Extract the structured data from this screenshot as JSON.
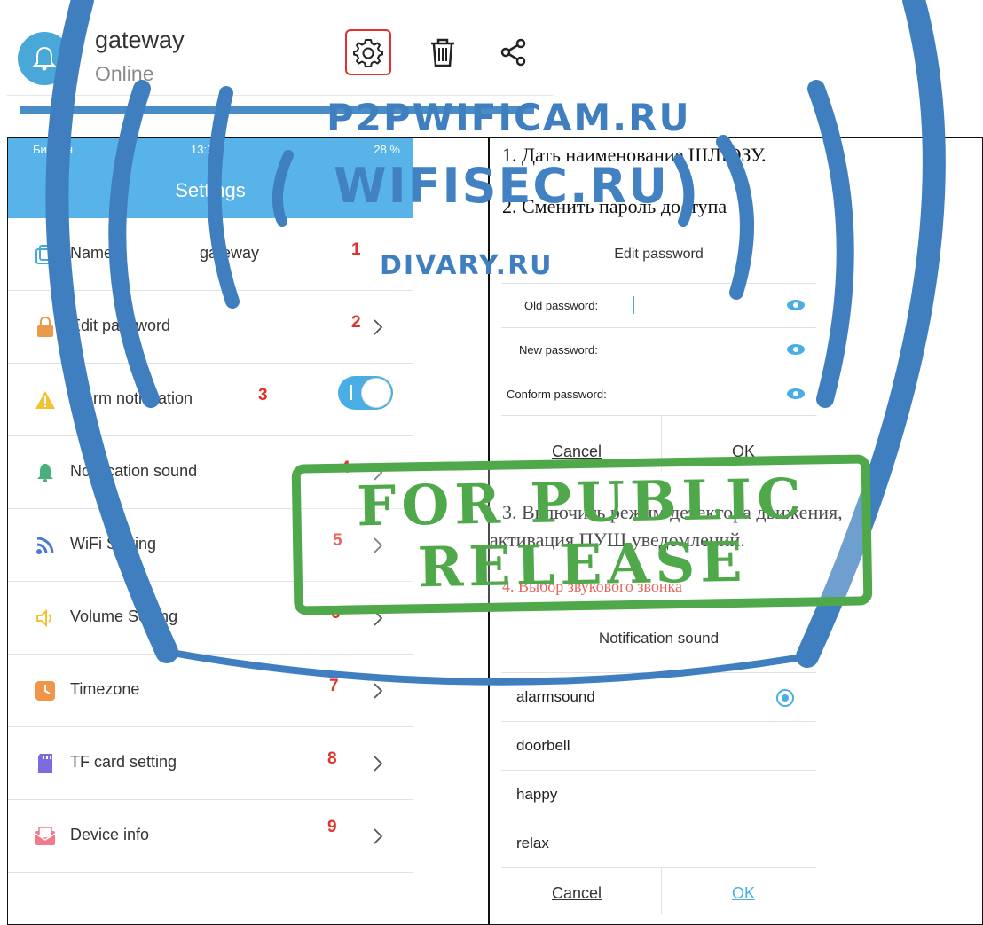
{
  "device": {
    "name": "gateway",
    "status": "Online"
  },
  "phone": {
    "carrier": "Билайн",
    "clock": "13:32",
    "battery": "28 %",
    "title": "Settings",
    "rows": [
      {
        "label": "Name",
        "value": "gateway",
        "num": "1"
      },
      {
        "label": "Edit password",
        "num": "2"
      },
      {
        "label": "Alarm notification",
        "num": "3",
        "toggle": "on"
      },
      {
        "label": "Notification sound",
        "num": "4"
      },
      {
        "label": "WiFi Setting",
        "num": "5"
      },
      {
        "label": "Volume Setting",
        "num": "6"
      },
      {
        "label": "Timezone",
        "num": "7"
      },
      {
        "label": "TF card setting",
        "num": "8"
      },
      {
        "label": "Device info",
        "num": "9"
      }
    ]
  },
  "notes": {
    "n1": "1. Дать наименование ШЛЮЗУ.",
    "n2": "2. Сменить пароль доступа",
    "n3": "3. Включить режим детектора движения,",
    "n3b": "активация ПУШ уведомлений.",
    "n4": "4. Выбор звукового звонка"
  },
  "pw_dialog": {
    "title": "Edit password",
    "old": "Old password:",
    "new": "New password:",
    "confirm": "Conform password:",
    "cancel": "Cancel",
    "ok": "OK"
  },
  "sound_dialog": {
    "title": "Notification sound",
    "options": [
      "alarmsound",
      "doorbell",
      "happy",
      "relax"
    ],
    "selected": "alarmsound",
    "cancel": "Cancel",
    "ok": "OK"
  },
  "watermark": {
    "w1": "P2PWIFICAM.RU",
    "w2": "WIFISEC.RU",
    "w3": "DIVARY.RU",
    "stamp1": "FOR PUBLIC",
    "stamp2": "RELEASE"
  },
  "colors": {
    "accent": "#58b3e8",
    "marker": "#e0312b",
    "watermark": "#3f7fbf",
    "stamp": "#4fa84a"
  }
}
